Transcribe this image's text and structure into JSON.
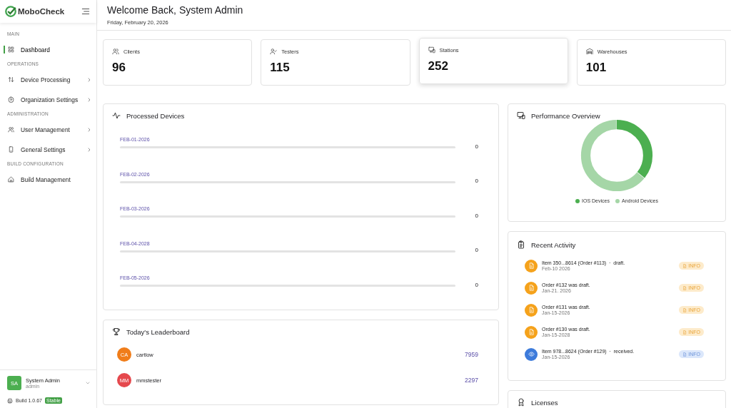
{
  "sidebar": {
    "brand": "MoboCheck",
    "sections": [
      {
        "label": "MAIN",
        "items": [
          {
            "label": "Dashboard",
            "selected": true,
            "kind": "link"
          }
        ]
      },
      {
        "label": "OPERATIONS",
        "items": [
          {
            "label": "Device Processing",
            "selected": false,
            "kind": "group"
          },
          {
            "label": "Organization Settings",
            "selected": false,
            "kind": "group"
          }
        ]
      },
      {
        "label": "ADMINISTRATION",
        "items": [
          {
            "label": "User Management",
            "selected": false,
            "kind": "group"
          },
          {
            "label": "General Settings",
            "selected": false,
            "kind": "group"
          }
        ]
      },
      {
        "label": "BUILD CONFIGURATION",
        "items": [
          {
            "label": "Build Management",
            "selected": false,
            "kind": "link"
          }
        ]
      }
    ],
    "user": {
      "initials": "SA",
      "name": "System Admin",
      "role": "admin"
    },
    "build": {
      "label": "Build 1.0.67",
      "badge": "Stable"
    }
  },
  "header": {
    "title": "Welcome Back, System Admin",
    "date": "Friday, February 20, 2026"
  },
  "stats": [
    {
      "label": "Clients",
      "value": "96",
      "selected": false
    },
    {
      "label": "Testers",
      "value": "115",
      "selected": false
    },
    {
      "label": "Stations",
      "value": "252",
      "selected": true
    },
    {
      "label": "Warehouses",
      "value": "101",
      "selected": false
    }
  ],
  "processed": {
    "title": "Processed Devices",
    "rows": [
      {
        "date": "FEB-01-2026",
        "level": 0,
        "count": "0"
      },
      {
        "date": "FEB-02-2026",
        "level": 0,
        "count": "0"
      },
      {
        "date": "FEB-03-2026",
        "level": 0,
        "count": "0"
      },
      {
        "date": "FEB-04-2028",
        "level": 0,
        "count": "0"
      },
      {
        "date": "FEB-05-2026",
        "level": 0,
        "count": "0"
      }
    ]
  },
  "leaderboard": {
    "title": "Today's Leaderboard",
    "rows": [
      {
        "initials": "CA",
        "name": "cartlow",
        "score": "7959",
        "color": "#f07d1a"
      },
      {
        "initials": "MM",
        "name": "mmstester",
        "score": "2297",
        "color": "#e5484d"
      }
    ]
  },
  "performance": {
    "title": "Performance Overview",
    "legend": [
      {
        "label": "IOS Devices",
        "color": "#4caf50"
      },
      {
        "label": "Android Devices",
        "color": "#a5d6a7"
      }
    ]
  },
  "activity": {
    "title": "Recent Activity",
    "items": [
      {
        "text": "Item 350...8614 (Order #113)  ·  draft.",
        "date": "Feb-10 2026",
        "kind": "draft",
        "badge": "INFO"
      },
      {
        "text": "Order #132 was draft.",
        "date": "Jan-21. 2026",
        "kind": "draft",
        "badge": "INFO"
      },
      {
        "text": "Order #131 was draft.",
        "date": "Jan-15-2026",
        "kind": "draft",
        "badge": "INFO"
      },
      {
        "text": "Order #130 was draft.",
        "date": "Jan-15-2028",
        "kind": "draft",
        "badge": "INFO"
      },
      {
        "text": "Item 978...8624 (Order #129)  ·  received.",
        "date": "Jan-15-2026",
        "kind": "received",
        "badge": "INFO"
      }
    ]
  },
  "licenses": {
    "title": "Licenses"
  }
}
